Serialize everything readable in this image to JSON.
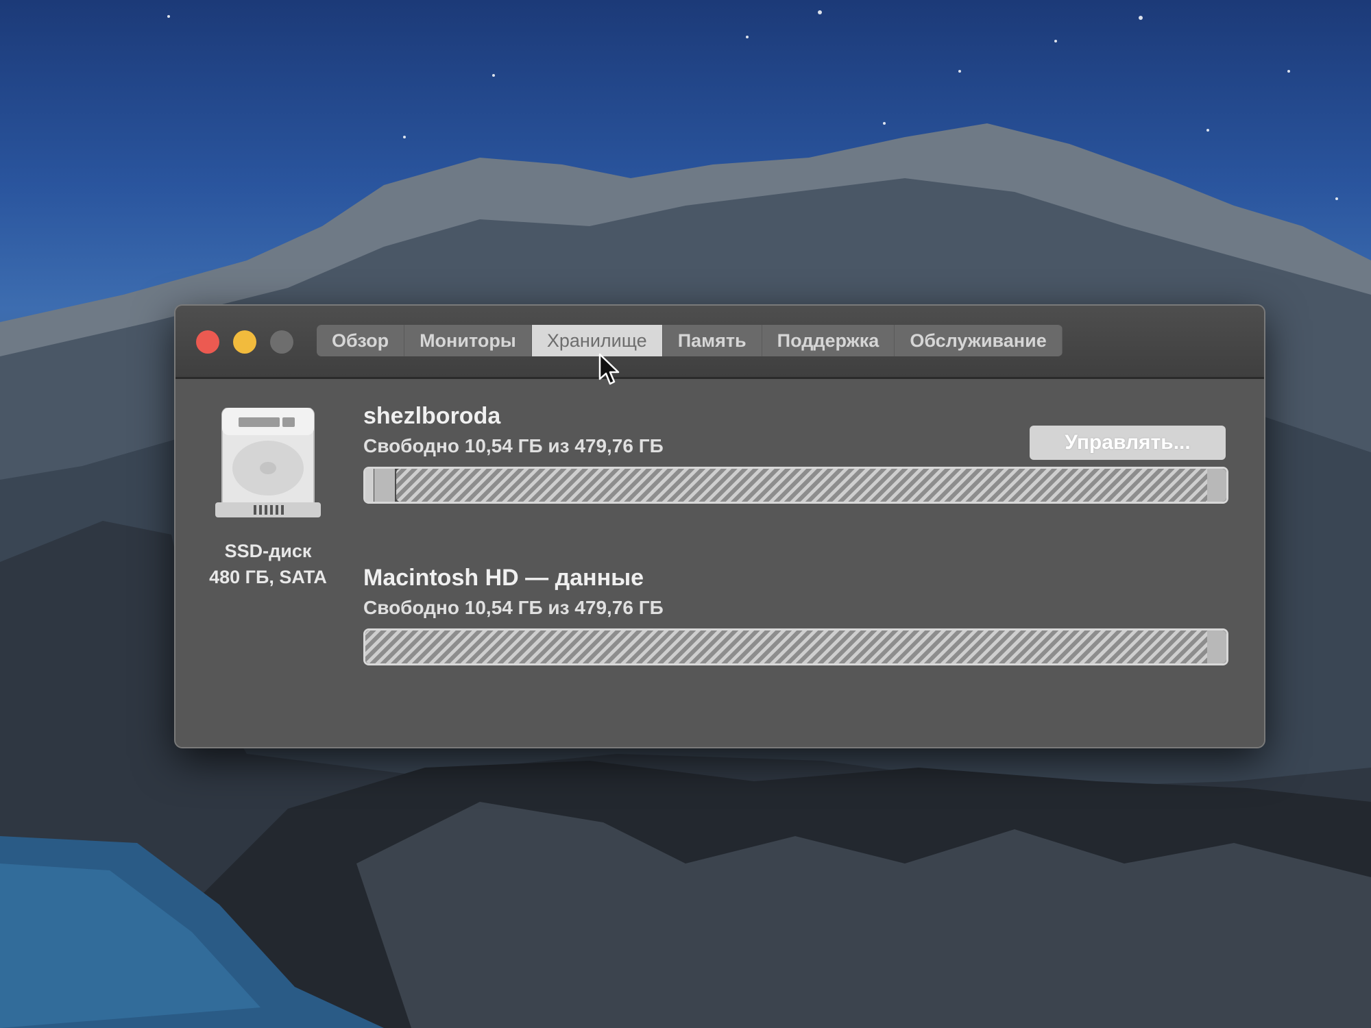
{
  "window": {
    "tabs": [
      {
        "label": "Обзор",
        "active": false
      },
      {
        "label": "Мониторы",
        "active": false
      },
      {
        "label": "Хранилище",
        "active": true
      },
      {
        "label": "Память",
        "active": false
      },
      {
        "label": "Поддержка",
        "active": false
      },
      {
        "label": "Обслуживание",
        "active": false
      }
    ]
  },
  "disk": {
    "icon": "hard-drive-icon",
    "type": "SSD-диск",
    "spec": "480 ГБ, SATA"
  },
  "volumes": [
    {
      "name": "shezlboroda",
      "free_text": "Свободно 10,54 ГБ из 479,76 ГБ",
      "used_fraction": 0.978
    },
    {
      "name": "Macintosh HD — данные",
      "free_text": "Свободно 10,54 ГБ из 479,76 ГБ",
      "used_fraction": 0.978
    }
  ],
  "manage_button": {
    "label": "Управлять..."
  },
  "colors": {
    "close": "#ec5a51",
    "minimize": "#f2bb3d",
    "zoom_inactive": "#6e6e6e",
    "window_bg": "#565656"
  }
}
